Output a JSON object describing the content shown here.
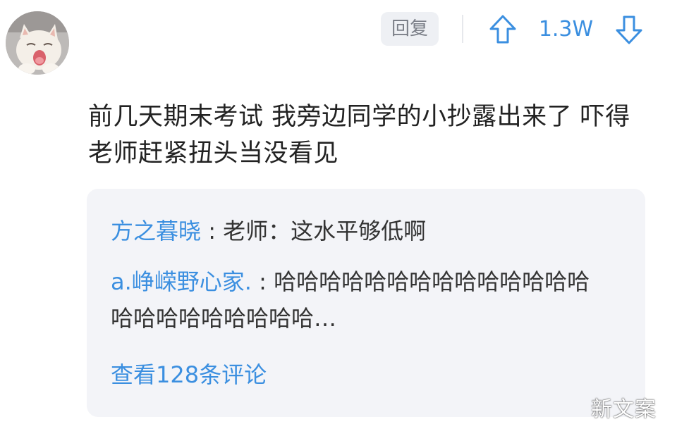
{
  "header": {
    "reply_label": "回复",
    "vote_count": "1.3W"
  },
  "icons": {
    "avatar": "cat-avatar",
    "upvote": "arrow-up-outline-icon",
    "downvote": "arrow-down-outline-icon"
  },
  "comment": {
    "text": "前几天期末考试 我旁边同学的小抄露出来了 吓得老师赶紧扭头当没看见"
  },
  "replies": [
    {
      "author": "方之暮晓",
      "separator": " : ",
      "content": "老师：这水平够低啊"
    },
    {
      "author": "a.峥嵘野心家.",
      "separator": " : ",
      "content": "哈哈哈哈哈哈哈哈哈哈哈哈哈哈哈哈哈哈哈哈哈哈哈…"
    }
  ],
  "view_more_label": "查看128条评论",
  "watermark": "新文案",
  "colors": {
    "accent": "#3b8fe0",
    "panel_bg": "#f3f4f8",
    "reply_btn_bg": "#eef0f4"
  }
}
